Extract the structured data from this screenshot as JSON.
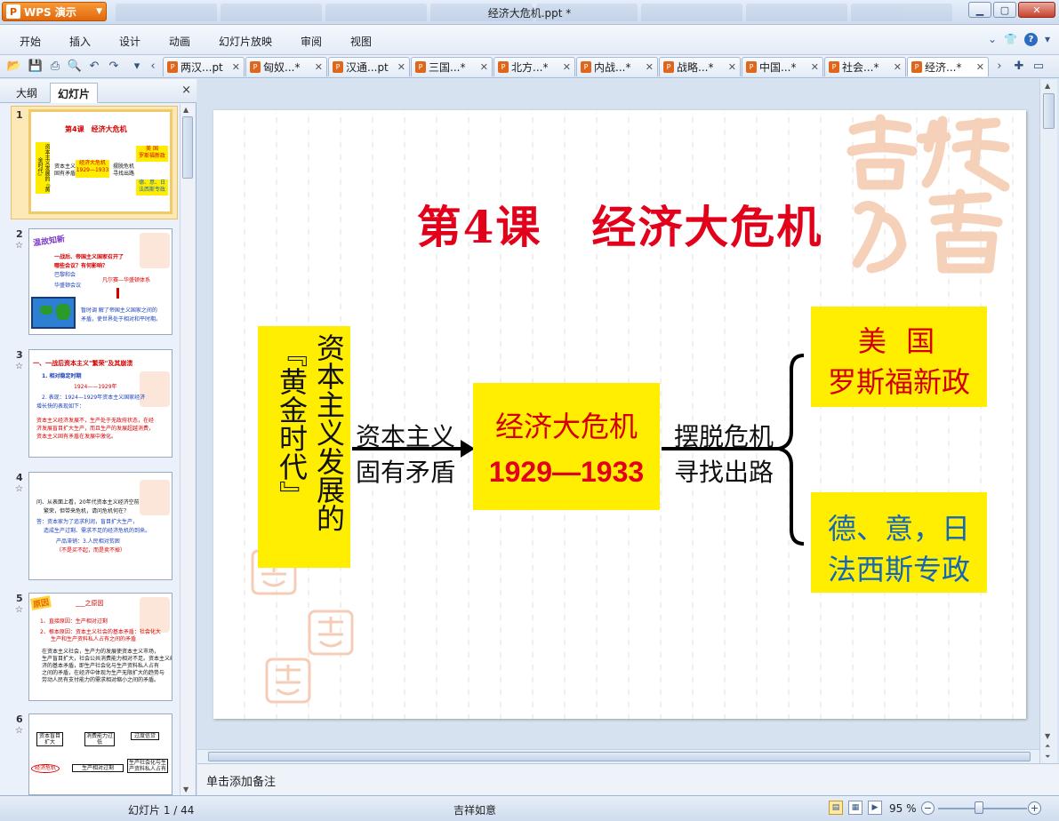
{
  "app": {
    "menu_button": "WPS 演示",
    "window_title": "经济大危机.ppt *"
  },
  "menubar": {
    "items": [
      "开始",
      "插入",
      "设计",
      "动画",
      "幻灯片放映",
      "审阅",
      "视图"
    ]
  },
  "doc_tabs": [
    {
      "label": "两汉...pt",
      "active": false
    },
    {
      "label": "匈奴...*",
      "active": false
    },
    {
      "label": "汉通...pt",
      "active": false
    },
    {
      "label": "三国...*",
      "active": false
    },
    {
      "label": "北方...*",
      "active": false
    },
    {
      "label": "内战...*",
      "active": false
    },
    {
      "label": "战略...*",
      "active": false
    },
    {
      "label": "中国...*",
      "active": false
    },
    {
      "label": "社会...*",
      "active": false
    },
    {
      "label": "经济...*",
      "active": true
    }
  ],
  "left_panel": {
    "tabs": [
      "大纲",
      "幻灯片"
    ],
    "active_tab": "幻灯片",
    "close": "×",
    "thumbnails": [
      {
        "num": "1",
        "title": "第4课　经济大危机",
        "vert": "资本主义发展的『黄金时代』",
        "lines": [
          "资本主义",
          "固有矛盾",
          "经济大危机",
          "1929—1933",
          "摆脱危机",
          "寻找出路",
          "美 国",
          "罗斯福新政",
          "德、意、日",
          "法西斯专政"
        ]
      },
      {
        "num": "2",
        "title": "温故知新",
        "lines": [
          "一战后、帝国主义国家召开了",
          "哪些会议？有何影响？",
          "巴黎和会",
          "华盛顿会议",
          "凡尔赛—华盛顿体系",
          "暂时调 解了帝国主义国家之间的",
          "矛盾，使世界处于相对和平时期。"
        ]
      },
      {
        "num": "3",
        "title": "一、一战后资本主义\"繁荣\"及其崩溃",
        "lines": [
          "1. 相对稳定时期",
          "1924——1929年",
          "2. 表现：1924—1929年资本主义国家经济",
          "增长快的表现如下：",
          "资本主义经济发展不，生产处于无政府状态，在经",
          "济发展盲目扩大生产，而且生产的发展超越消费，",
          "资本主义固有矛盾在发展中激化。"
        ]
      },
      {
        "num": "4",
        "title": "",
        "lines": [
          "问、从表面上看，20年代资本主义经济空前",
          "繁荣，但带来危机，请问危机何在？",
          "答：资本家为了追求利润，盲目扩大生产，",
          "造成生产过剩、需求不足的经济危机的到来。",
          "产品滞销：3.人民相对贫困",
          "（不是买不起，而是卖不掉）"
        ]
      },
      {
        "num": "5",
        "title": "原因",
        "lines": [
          "___之原因",
          "1、直接原因：生产相对过剩",
          "2、根本原因：资本主义社会的基本矛盾：社会化大",
          "生产和生产资料私人占有之间的矛盾",
          "在资本主义社会，生产力的发展使资本主义市场，",
          "生产盲目扩大，社会公共消费能力相对不足。资本主义经",
          "济的基本矛盾，即生产社会化与生产资料私人占有",
          "之间的矛盾，在经济中体现为生产无限扩大的趋势与",
          "劳动人民有支付能力的需求相对缩小之间的矛盾。"
        ]
      },
      {
        "num": "6",
        "title": "",
        "lines": [
          "资本盲目扩大",
          "消费能力过低",
          "过度信贷",
          "经济危机",
          "生产相对过剩",
          "生产社会化与生产资料私人占有"
        ]
      }
    ]
  },
  "slide": {
    "title_part1": "第4课",
    "title_part2": "经济大危机",
    "vertical_box": {
      "col1": "资本主义发展的",
      "col2": "『黄金时代』"
    },
    "left_arrow_label": {
      "line1": "资本主义",
      "line2": "固有矛盾"
    },
    "center_box": {
      "line1": "经济大危机",
      "line2": "1929—1933"
    },
    "right_arrow_label": {
      "line1": "摆脱危机",
      "line2": "寻找出路"
    },
    "top_right_box": {
      "line1": "美 国",
      "line2": "罗斯福新政"
    },
    "bottom_right_box": {
      "line1": "德、意，日",
      "line2": "法西斯专政"
    },
    "colors": {
      "title_red": "#e2001a",
      "box_yellow": "#ffee00",
      "blue_text": "#1466b8"
    }
  },
  "notes": {
    "placeholder": "单击添加备注"
  },
  "statusbar": {
    "slide_info": "幻灯片 1 / 44",
    "theme": "吉祥如意",
    "zoom": "95 %",
    "zoom_level_percent": 95
  }
}
